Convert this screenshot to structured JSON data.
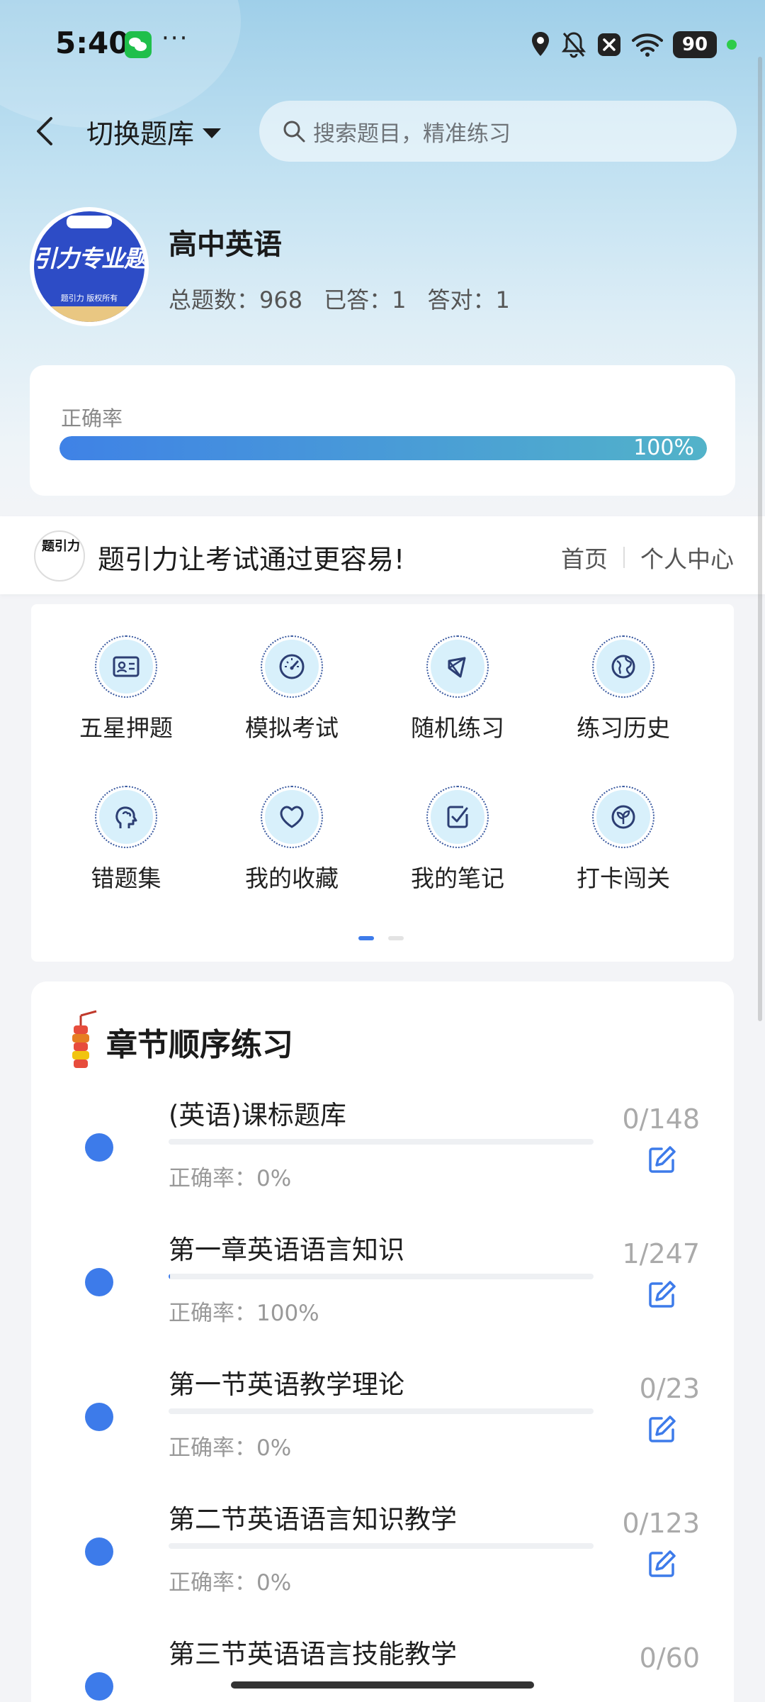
{
  "status_bar": {
    "time": "5:40",
    "battery": "90",
    "more": "···"
  },
  "header": {
    "switch_label": "切换题库",
    "search_placeholder": "搜索题目，精准练习"
  },
  "subject": {
    "avatar_text": "引力专业题",
    "avatar_small": "题引力 版权所有",
    "title": "高中英语",
    "total": "总题数：968",
    "answered": "已答：1",
    "correct": "答对：1"
  },
  "accuracy": {
    "label": "正确率",
    "value_text": "100%",
    "fraction": 1.0
  },
  "banner": {
    "slogan": "题引力让考试通过更容易!",
    "nav_home": "首页",
    "nav_profile": "个人中心"
  },
  "tools": [
    {
      "label": "五星押题",
      "icon": "id-card-icon"
    },
    {
      "label": "模拟考试",
      "icon": "speedometer-icon"
    },
    {
      "label": "随机练习",
      "icon": "network-icon"
    },
    {
      "label": "练习历史",
      "icon": "globe-icon"
    },
    {
      "label": "错题集",
      "icon": "brain-head-icon"
    },
    {
      "label": "我的收藏",
      "icon": "heart-icon"
    },
    {
      "label": "我的笔记",
      "icon": "note-check-icon"
    },
    {
      "label": "打卡闯关",
      "icon": "sprout-icon"
    }
  ],
  "chapters": {
    "title": "章节顺序练习",
    "items": [
      {
        "name": "(英语)课标题库",
        "accuracy": "正确率：0%",
        "count": "0/148",
        "progress": 0
      },
      {
        "name": "第一章英语语言知识",
        "accuracy": "正确率：100%",
        "count": "1/247",
        "progress": 0.004
      },
      {
        "name": "第一节英语教学理论",
        "accuracy": "正确率：0%",
        "count": "0/23",
        "progress": 0
      },
      {
        "name": "第二节英语语言知识教学",
        "accuracy": "正确率：0%",
        "count": "0/123",
        "progress": 0
      },
      {
        "name": "第三节英语语言技能教学",
        "accuracy": "",
        "count": "0/60",
        "progress": 0
      }
    ]
  },
  "colors": {
    "accent": "#3d7bea",
    "progress_end": "#52b3c9"
  }
}
